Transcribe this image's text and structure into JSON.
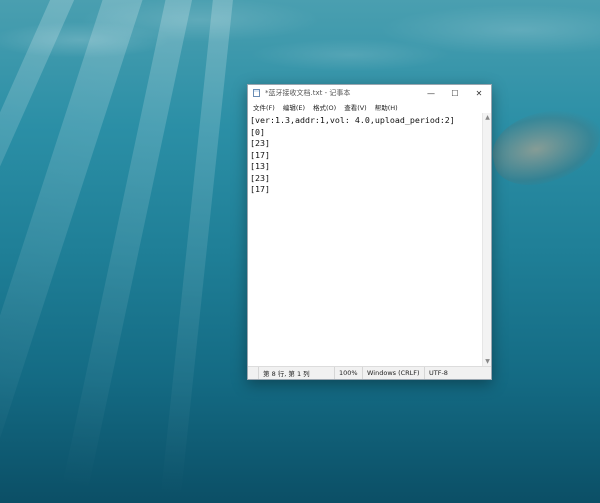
{
  "window": {
    "title": "*蓝牙接收文档.txt - 记事本",
    "controls": {
      "minimize": "—",
      "maximize": "☐",
      "close": "✕"
    }
  },
  "menu": {
    "items": [
      {
        "label": "文件(F)"
      },
      {
        "label": "编辑(E)"
      },
      {
        "label": "格式(O)"
      },
      {
        "label": "查看(V)"
      },
      {
        "label": "帮助(H)"
      }
    ]
  },
  "editor": {
    "lines": [
      "[ver:1.3,addr:1,vol: 4.0,upload_period:2]",
      "[0]",
      "[23]",
      "[17]",
      "[13]",
      "[23]",
      "[17]"
    ]
  },
  "status": {
    "position": "第 8 行, 第 1 列",
    "zoom": "100%",
    "line_ending": "Windows (CRLF)",
    "encoding": "UTF-8"
  },
  "colors": {
    "water_top": "#4a9fb0",
    "water_bottom": "#0b4f66",
    "window_bg": "#ffffff"
  }
}
